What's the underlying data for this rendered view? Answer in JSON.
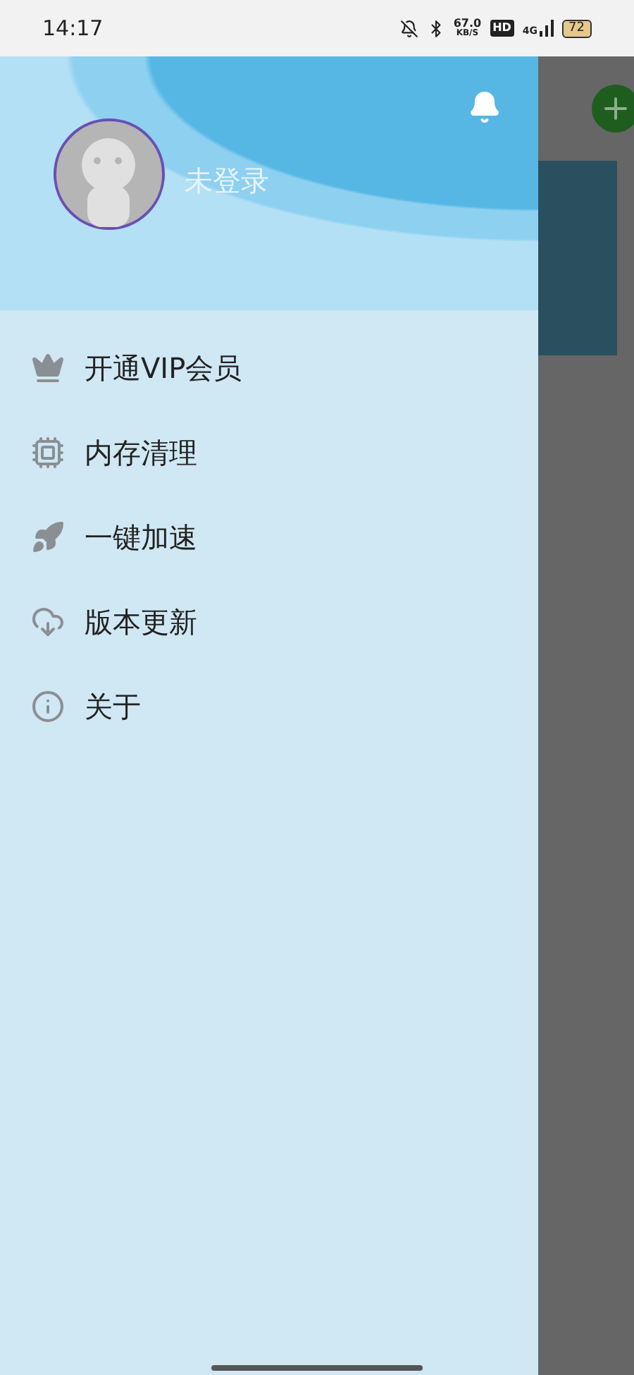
{
  "status_bar": {
    "time": "14:17",
    "net_speed": "67.0",
    "net_unit": "KB/S",
    "hd": "HD",
    "network": "4G",
    "battery": "72"
  },
  "drawer": {
    "user": {
      "name": "未登录"
    },
    "menu": [
      {
        "kind": "crown",
        "label": "开通VIP会员"
      },
      {
        "kind": "chip",
        "label": "内存清理"
      },
      {
        "kind": "rocket",
        "label": "一键加速"
      },
      {
        "kind": "cloud",
        "label": "版本更新"
      },
      {
        "kind": "info",
        "label": "关于"
      }
    ]
  }
}
